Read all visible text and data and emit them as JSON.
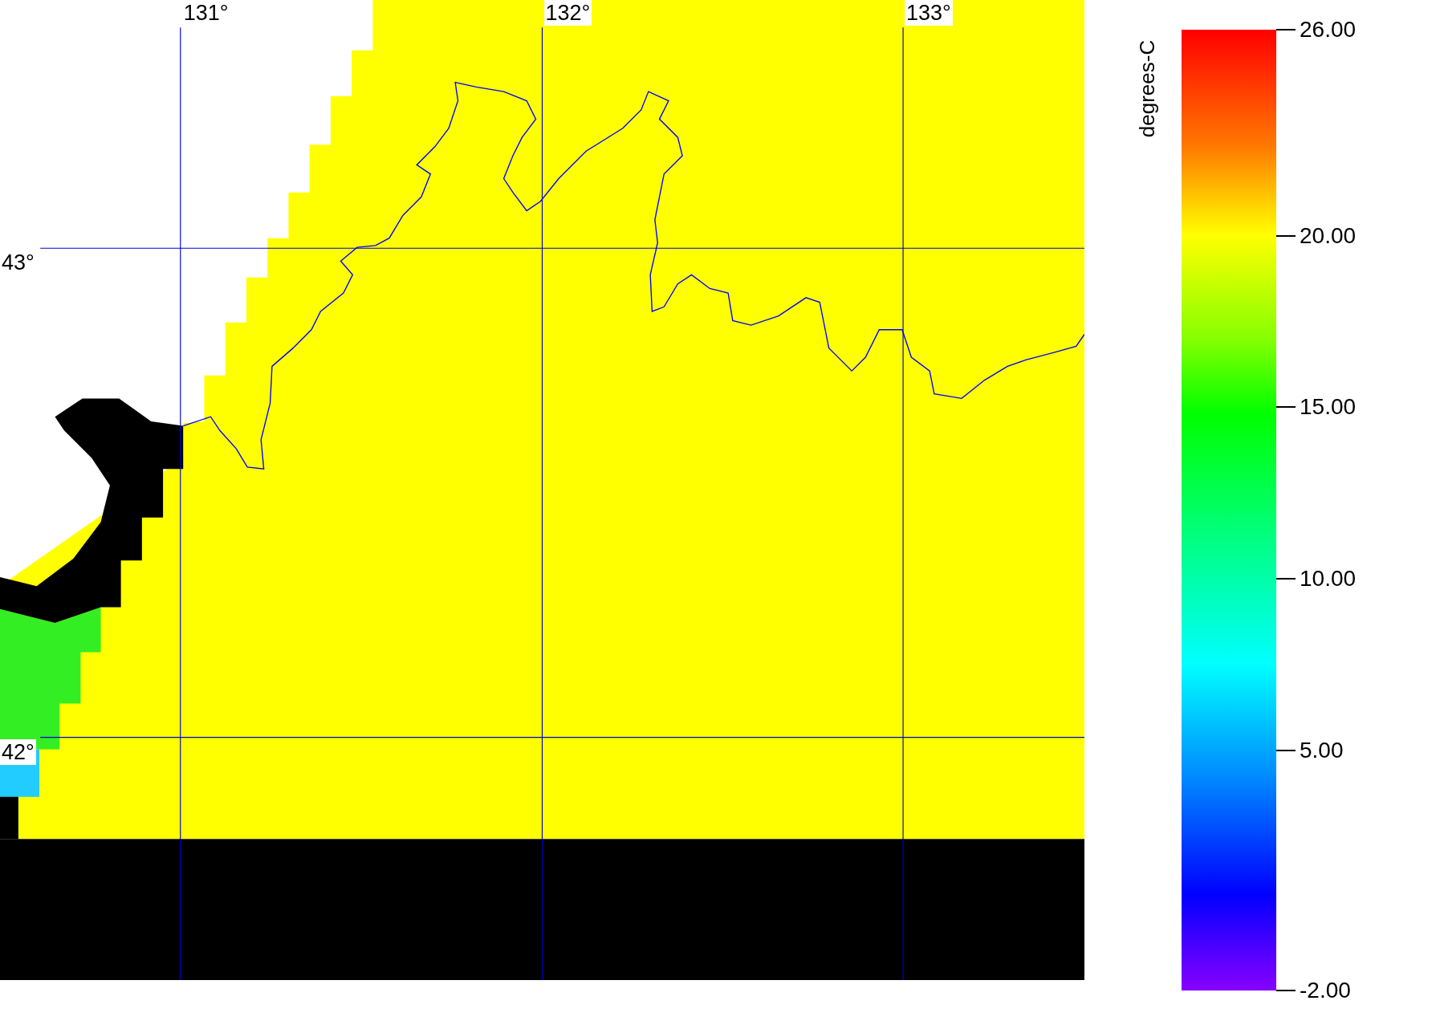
{
  "map": {
    "longitude_labels": [
      "131°",
      "132°",
      "133°"
    ],
    "latitude_labels": [
      "43°",
      "42°"
    ]
  },
  "colorbar": {
    "title": "degrees-C",
    "ticks": [
      "26.00",
      "20.00",
      "15.00",
      "10.00",
      "5.00",
      "-2.00"
    ]
  }
}
